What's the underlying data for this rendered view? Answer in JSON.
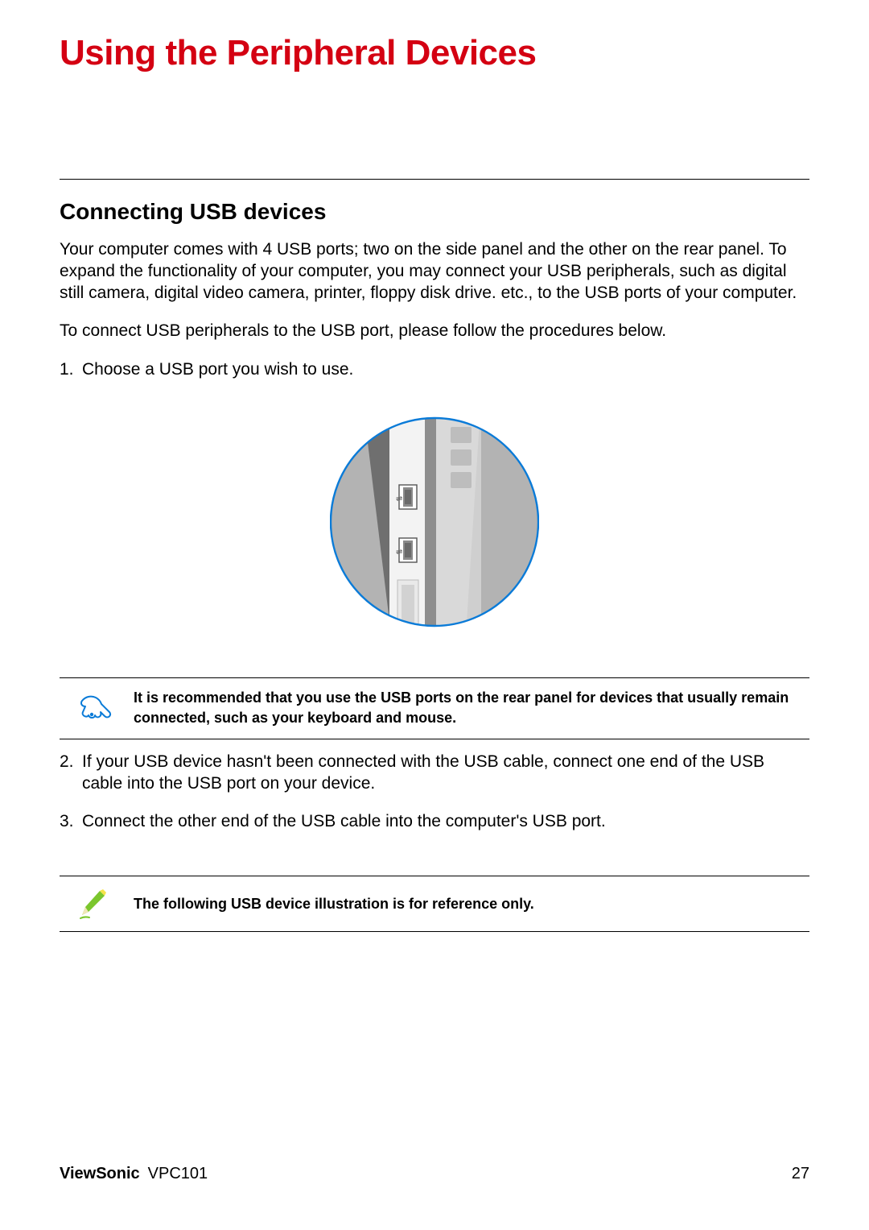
{
  "title": "Using the Peripheral Devices",
  "section": {
    "heading": "Connecting USB devices",
    "p1": "Your computer comes with 4 USB ports; two on the side panel and the other on the rear panel. To expand the functionality of your computer, you may connect your USB peripherals, such as digital still camera, digital video camera, printer, floppy disk drive. etc., to the USB ports of your computer.",
    "p2": "To connect USB peripherals to the USB port, please follow the procedures below.",
    "steps": [
      "Choose a USB port you wish to use.",
      "If your USB device hasn't been connected with the USB cable, connect one end of the USB cable into the USB port on your device.",
      "Connect the other end of the USB cable into the computer's USB port."
    ]
  },
  "notes": {
    "tip": "It is recommended that you use the USB ports on the rear panel for devices that usually remain connected, such as your keyboard and mouse.",
    "reference": "The following USB device illustration is for reference only."
  },
  "footer": {
    "brand": "ViewSonic",
    "model": "VPC101",
    "page": "27"
  },
  "colors": {
    "title": "#d40012",
    "circle_stroke": "#0a7bd8",
    "tip_icon": "#0a7bd8",
    "note_icon_green": "#7bc62d",
    "note_icon_yellow": "#f6e34a"
  }
}
